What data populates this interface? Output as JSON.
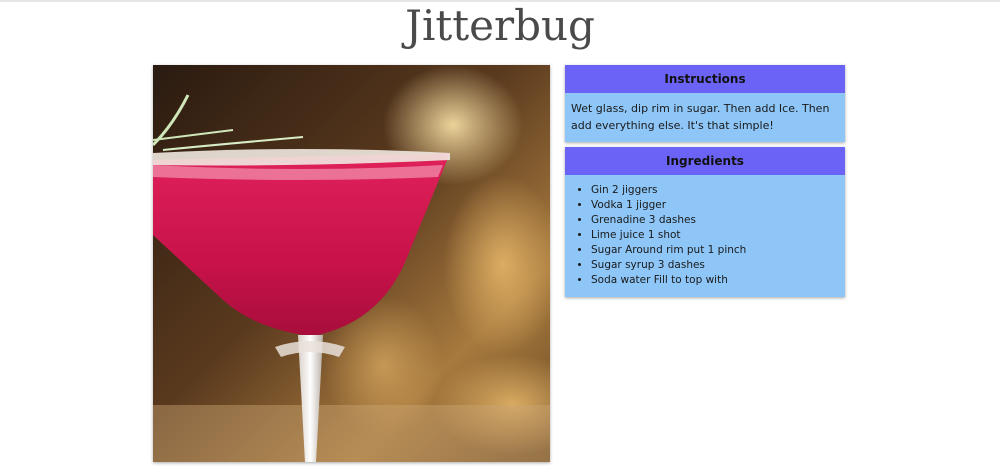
{
  "page": {
    "title": "Jitterbug"
  },
  "image": {
    "subject": "cocktail-glass"
  },
  "instructions": {
    "header": "Instructions",
    "text": "Wet glass, dip rim in sugar. Then add Ice. Then add everything else. It's that simple!"
  },
  "ingredients": {
    "header": "Ingredients",
    "items": [
      "Gin 2 jiggers",
      "Vodka 1 jigger",
      "Grenadine 3 dashes",
      "Lime juice 1 shot",
      "Sugar Around rim put 1 pinch",
      "Sugar syrup 3 dashes",
      "Soda water Fill to top with"
    ]
  },
  "colors": {
    "card_header": "#6b63f5",
    "card_body": "#8ec6f8",
    "drink": "#d6164f"
  }
}
